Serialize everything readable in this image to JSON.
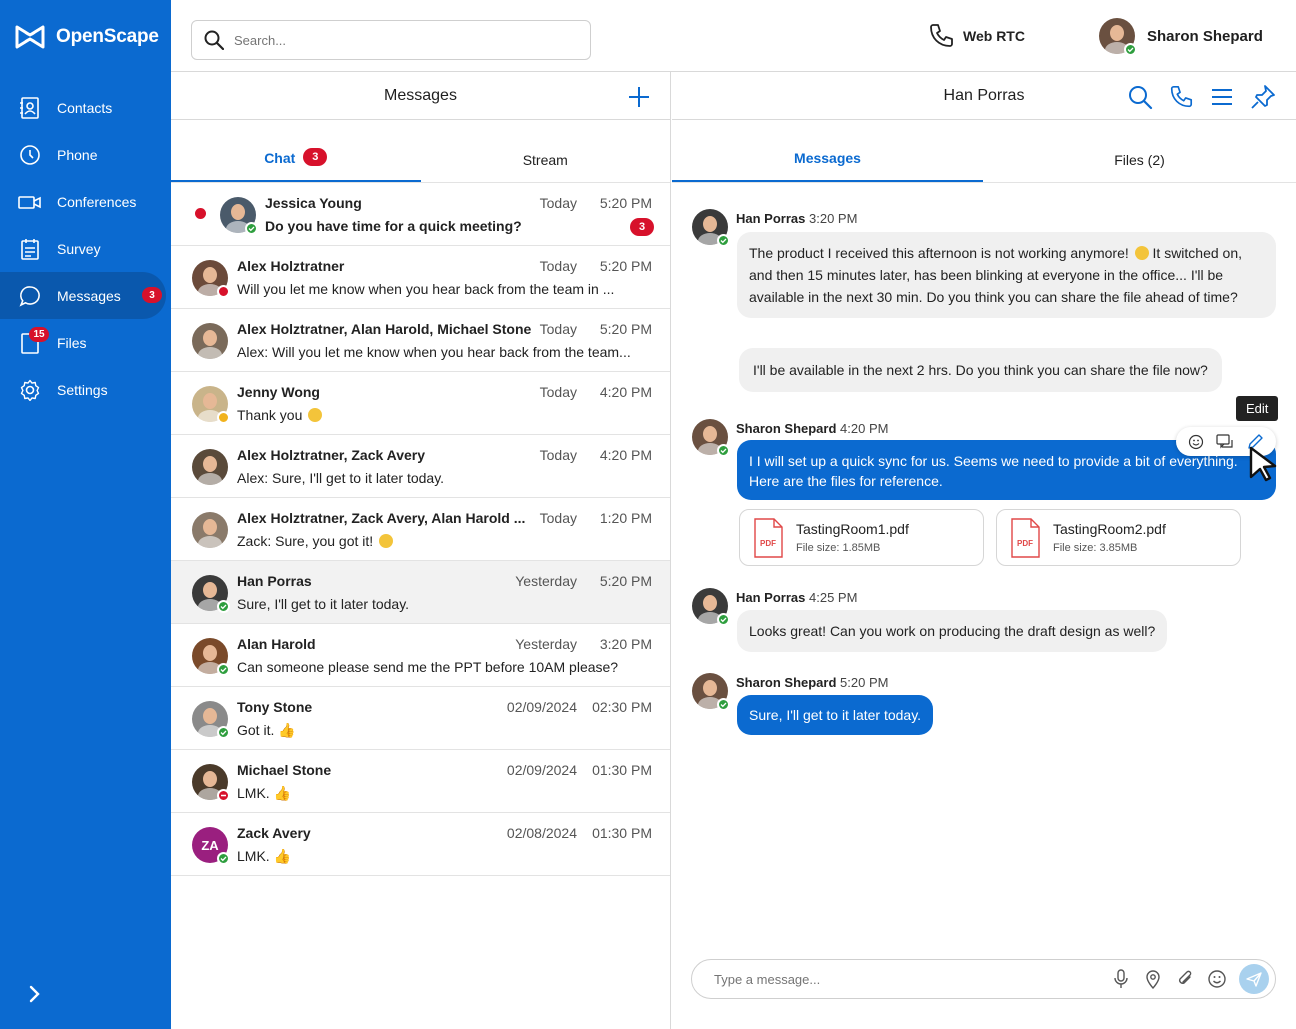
{
  "app": {
    "name": "OpenScape"
  },
  "sidebar": {
    "items": [
      {
        "label": "Contacts",
        "icon": "contacts-icon"
      },
      {
        "label": "Phone",
        "icon": "phone-history-icon"
      },
      {
        "label": "Conferences",
        "icon": "conference-camera-icon"
      },
      {
        "label": "Survey",
        "icon": "survey-icon"
      },
      {
        "label": "Messages",
        "icon": "chat-bubble-icon",
        "badge": "3",
        "active": true
      },
      {
        "label": "Files",
        "icon": "file-icon",
        "badge": "15"
      },
      {
        "label": "Settings",
        "icon": "gear-icon"
      }
    ]
  },
  "topbar": {
    "search_placeholder": "Search...",
    "webrtc_label": "Web RTC",
    "user_name": "Sharon Shepard"
  },
  "messages_panel": {
    "title": "Messages",
    "tabs": [
      {
        "label": "Chat",
        "badge": "3"
      },
      {
        "label": "Stream"
      }
    ],
    "conversations": [
      {
        "name": "Jessica Young",
        "date": "Today",
        "time": "5:20 PM",
        "message": "Do you have time for a quick meeting?",
        "unread": true,
        "count": "3",
        "status": "online",
        "avatar_color": "#4a5a6a"
      },
      {
        "name": "Alex Holztratner",
        "date": "Today",
        "time": "5:20 PM",
        "message": "Will you let me know when you hear back from the team in ...",
        "status": "busy",
        "avatar_color": "#6b4a3a"
      },
      {
        "name": "Alex Holztratner, Alan Harold, Michael Stone",
        "date": "Today",
        "time": "5:20 PM",
        "message": "Alex: Will you let me know when you hear back from the team...",
        "status": "",
        "avatar_color": "#7a6a5a"
      },
      {
        "name": "Jenny Wong",
        "date": "Today",
        "time": "4:20 PM",
        "message": "Thank you",
        "emoji": "smile",
        "status": "away",
        "avatar_color": "#c9b48a"
      },
      {
        "name": "Alex Holztratner, Zack Avery",
        "date": "Today",
        "time": "4:20 PM",
        "message": "Alex: Sure, I'll get to it later today.",
        "status": "",
        "avatar_color": "#5a4a3a"
      },
      {
        "name": "Alex Holztratner, Zack Avery, Alan Harold ...",
        "date": "Today",
        "time": "1:20 PM",
        "message": "Zack: Sure, you got it!",
        "emoji": "grin",
        "status": "",
        "avatar_color": "#8a7a6a"
      },
      {
        "name": "Han Porras",
        "date": "Yesterday",
        "time": "5:20 PM",
        "message": "Sure, I'll get to it later today.",
        "status": "online",
        "selected": true,
        "avatar_color": "#3a3a3a"
      },
      {
        "name": "Alan Harold",
        "date": "Yesterday",
        "time": "3:20 PM",
        "message": "Can someone please send me the PPT before 10AM please?",
        "status": "online",
        "avatar_color": "#7a4a2a"
      },
      {
        "name": "Tony Stone",
        "date": "02/09/2024",
        "time": "02:30 PM",
        "message": "Got it.",
        "emoji": "thumbs-up",
        "status": "online",
        "avatar_color": "#8a8a8a"
      },
      {
        "name": "Michael Stone",
        "date": "02/09/2024",
        "time": "01:30 PM",
        "message": "LMK.",
        "emoji": "thumbs-up",
        "status": "dnd",
        "avatar_color": "#4a3a2a"
      },
      {
        "name": "Zack Avery",
        "date": "02/08/2024",
        "time": "01:30 PM",
        "message": "LMK.",
        "emoji": "thumbs-up",
        "status": "online",
        "initials": "ZA",
        "avatar_color": "#9a1f7f"
      }
    ]
  },
  "chat_panel": {
    "title": "Han Porras",
    "tabs": [
      {
        "label": "Messages"
      },
      {
        "label": "Files (2)"
      }
    ],
    "messages": [
      {
        "sender": "Han Porras",
        "time": "3:20 PM",
        "text1": "The product I received this afternoon is not working anymore!",
        "text2": "It switched on, and then 15 minutes later, has been blinking at everyone in the office... I'll be available in the next 30 min. Do you think you can share the file ahead of time?",
        "text3": "I'll be available in the next 2 hrs. Do you think you can share the file now?"
      },
      {
        "sender": "Sharon Shepard",
        "time": "4:20 PM",
        "text": "I I will set up a quick sync for us. Seems we need to provide a bit of everything. Here are the files for reference."
      },
      {
        "sender": "Han Porras",
        "time": "4:25 PM",
        "text": "Looks great! Can you work on producing the draft design as well?"
      },
      {
        "sender": "Sharon Shepard",
        "time": "5:20 PM",
        "text": "Sure, I'll get to it later today."
      }
    ],
    "files": [
      {
        "name": "TastingRoom1.pdf",
        "size": "File size: 1.85MB",
        "type": "PDF"
      },
      {
        "name": "TastingRoom2.pdf",
        "size": "File size: 3.85MB",
        "type": "PDF"
      }
    ],
    "tooltip": "Edit",
    "composer_placeholder": "Type a message..."
  },
  "colors": {
    "brand": "#0b6ad0",
    "alert": "#d7112b",
    "online": "#2e9e3e"
  }
}
